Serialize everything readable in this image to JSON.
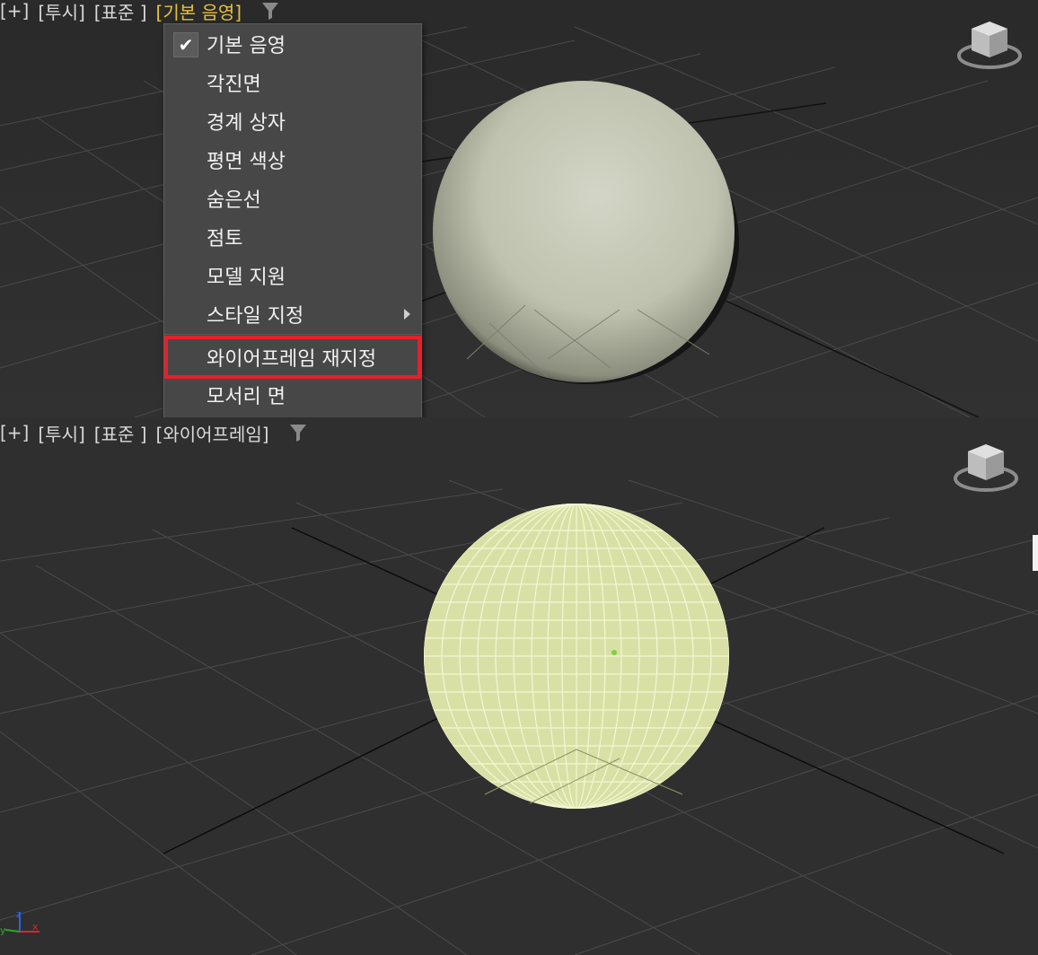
{
  "top_viewport": {
    "labels": {
      "plus": "[+]",
      "view": "[투시]",
      "standard": "[표준 ]",
      "shading": "[기본 음영]"
    },
    "menu": {
      "items": [
        {
          "label": "기본 음영",
          "checked": true
        },
        {
          "label": "각진면"
        },
        {
          "label": "경계 상자"
        },
        {
          "label": "평면 색상"
        },
        {
          "label": "숨은선"
        },
        {
          "label": "점토"
        },
        {
          "label": "모델 지원"
        },
        {
          "label": "스타일  지정",
          "submenu": true
        },
        {
          "label": "와이어프레임 재지정",
          "highlighted": true
        },
        {
          "label": "모서리 면"
        }
      ]
    }
  },
  "bottom_viewport": {
    "labels": {
      "plus": "[+]",
      "view": "[투시]",
      "standard": "[표준 ]",
      "shading": "[와이어프레임]"
    }
  },
  "icons": {
    "viewcube": "viewcube-icon",
    "filter": "filter-icon",
    "check": "checkmark-icon",
    "submenu": "submenu-arrow-icon",
    "axis": "axis-tripod-icon"
  },
  "colors": {
    "active_label": "#e8c23a",
    "highlight_border": "#e3222c",
    "sphere": "#c9cbb8",
    "wireframe": "#eef2b8"
  }
}
